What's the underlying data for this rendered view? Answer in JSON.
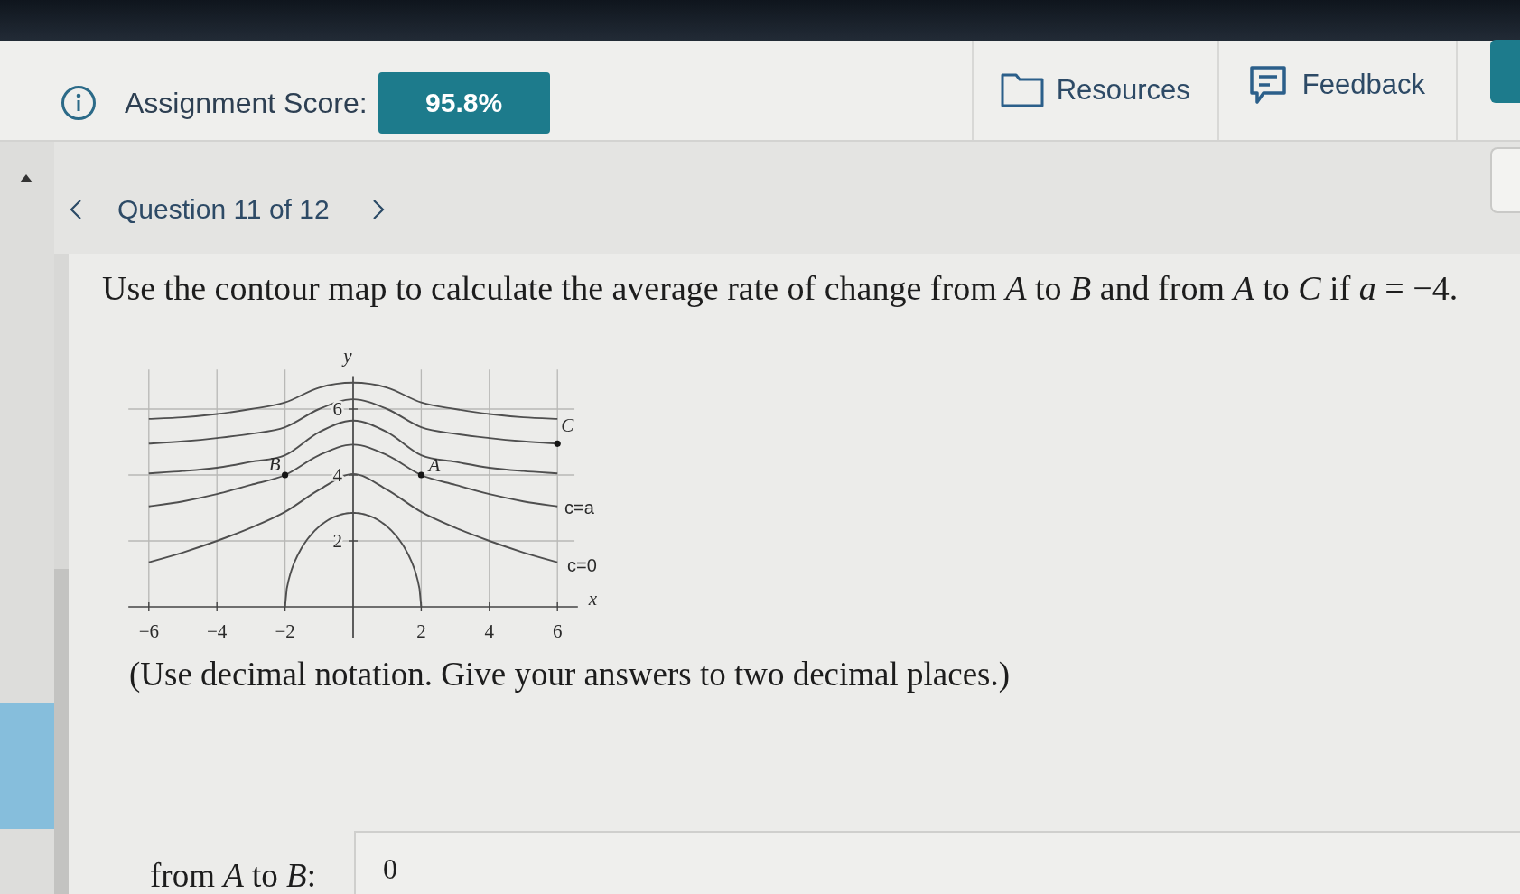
{
  "header": {
    "score_label": "Assignment Score:",
    "score": "95.8%",
    "links": [
      {
        "kind": "folder",
        "label": "Resources"
      },
      {
        "kind": "feedback",
        "label": "Feedback"
      }
    ]
  },
  "question_nav": {
    "title": "Question 11 of 12"
  },
  "question": {
    "prompt": "Use the contour map to calculate the average rate of change from *A* to *B* and from *A* to *C* if *a* = −4.",
    "figure": {
      "ylabel": "y",
      "xlabel": "x",
      "xticks": [
        "−6",
        "−4",
        "−2",
        "2",
        "4",
        "6"
      ],
      "yticks": [
        "6",
        "4",
        "2"
      ],
      "points": [
        {
          "label": "A"
        },
        {
          "label": "B"
        },
        {
          "label": "C"
        }
      ],
      "contour_labels": [
        "c=a",
        "c=0"
      ]
    },
    "instructions": "(Use decimal notation. Give your answers to two decimal places.)",
    "answers": [
      {
        "label": "from *A* to *B*:",
        "value": "0"
      }
    ]
  }
}
